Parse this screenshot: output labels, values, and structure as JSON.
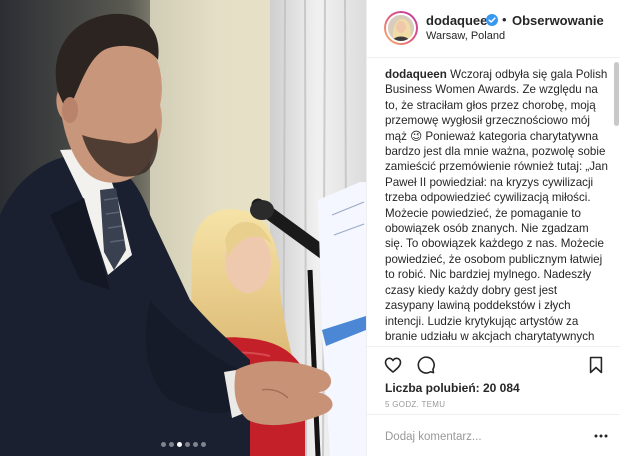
{
  "post": {
    "username": "dodaqueen",
    "follow_label": "Obserwowanie",
    "separator": "•",
    "location": "Warsaw, Poland",
    "caption_user": "dodaqueen",
    "caption_text": "Wczoraj odbyła się gala Polish Business Women Awards. Ze względu na to, że straciłam głos przez chorobę, moją przemowę wygłosił grzecznościowo mój mąż 😉  Ponieważ kategoria charytatywna bardzo jest dla mnie ważna, pozwolę sobie zamieścić przemówienie również tutaj: „Jan Paweł II powiedział: na kryzys cywilizacji trzeba odpowiedzieć cywilizacją miłości. Możecie powiedzieć, że pomaganie to obowiązek osób znanych. Nie zgadzam się. To obowiązek każdego z nas. Możecie powiedzieć, że osobom publicznym łatwiej to robić. Nic bardziej mylnego. Nadeszły czasy kiedy każdy dobry gest jest zasypany lawiną poddekstów i złych intencji. Ludzie krytykując artystów za branie udziału w akcjach charytatywnych myślą, że zrobią im źle pisząc, że to tylko ocieplanie wizerunku. Prawda jest jednak",
    "likes_text": "Liczba polubień: 20 084",
    "timestamp": "5 godz. temu",
    "comment_placeholder": "Dodaj komentarz..."
  },
  "icons": {
    "verified": "verified-badge-icon",
    "like": "heart-icon",
    "comment": "speech-bubble-icon",
    "save": "bookmark-icon",
    "more": "ellipsis-icon"
  },
  "carousel": {
    "count": 6,
    "active_index": 2
  },
  "colors": {
    "verified": "#3897f0",
    "text": "#262626",
    "muted": "#999999",
    "border": "#efefef"
  }
}
